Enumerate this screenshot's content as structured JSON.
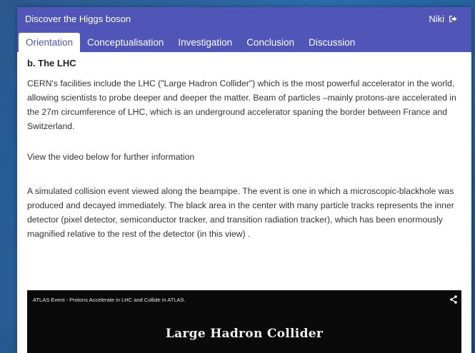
{
  "header": {
    "title": "Discover the Higgs boson",
    "user": "Niki",
    "logout_icon": "sign-out-icon"
  },
  "tabs": [
    {
      "label": "Orientation",
      "active": true
    },
    {
      "label": "Conceptualisation",
      "active": false
    },
    {
      "label": "Investigation",
      "active": false
    },
    {
      "label": "Conclusion",
      "active": false
    },
    {
      "label": "Discussion",
      "active": false
    }
  ],
  "content": {
    "section_title": "b. The LHC",
    "paragraph1": "CERN's facilities include the LHC (\"Large Hadron Collider\") which is the most powerful accelerator in the world, allowing scientists to probe deeper and deeper the matter. Beam of particles –mainly protons-are accelerated in the 27m circumference of LHC, which is an underground accelerator spaning the border between France and Switzerland.",
    "paragraph2": "View the video below for further information",
    "paragraph3": "A simulated collision event viewed along the beampipe. The event is one in which a microscopic-blackhole was produced and decayed immediately. The black area in the center with many particle tracks represents the inner detector (pixel detector, semiconductor tracker, and transition radiation tracker), which has been enormously magnified relative to the rest of the detector (in this view) ."
  },
  "video": {
    "title": "ATLAS Event - Protons Accelerate in LHC and Collide in ATLAS.",
    "overlay_text": "",
    "heading": "Large Hadron Collider",
    "share_icon": "share-icon"
  },
  "colors": {
    "accent": "#4f56b8",
    "page_background": "#2b6aa8",
    "video_background": "#0a0a0a"
  }
}
